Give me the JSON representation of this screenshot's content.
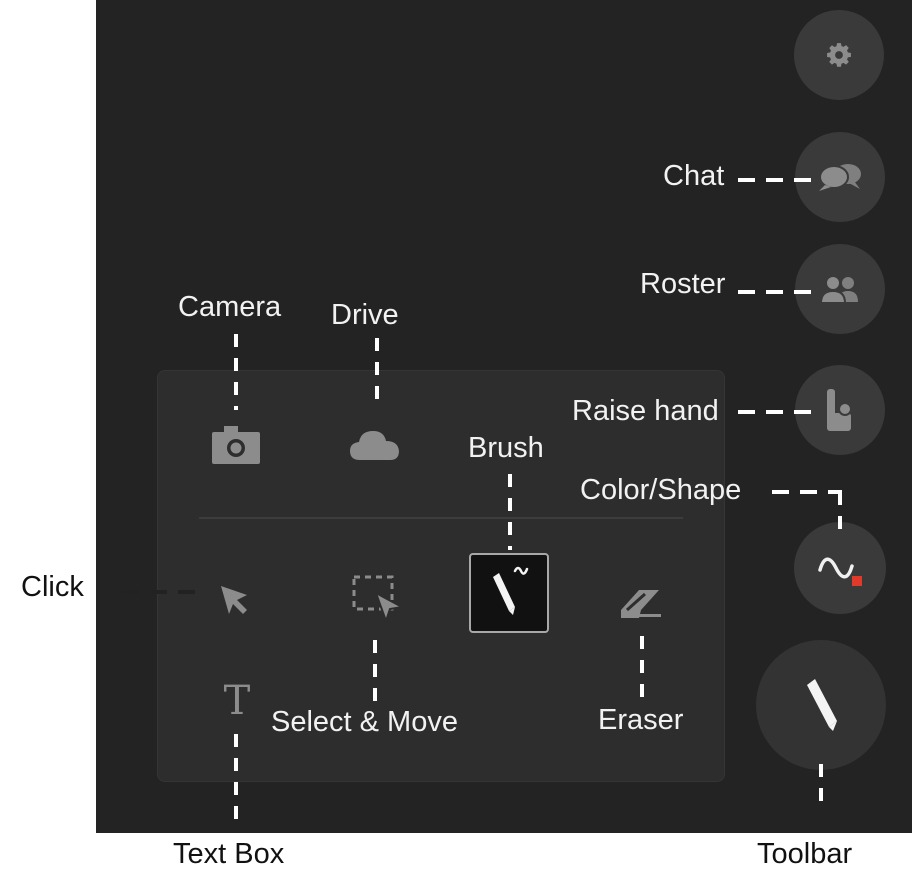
{
  "labels": {
    "chat": "Chat",
    "roster": "Roster",
    "raise_hand": "Raise hand",
    "color_shape": "Color/Shape",
    "camera": "Camera",
    "drive": "Drive",
    "brush": "Brush",
    "click": "Click",
    "select_move": "Select & Move",
    "eraser": "Eraser",
    "text_box": "Text Box",
    "toolbar": "Toolbar"
  },
  "tools": {
    "text_glyph": "T"
  },
  "icons": [
    "gear-icon",
    "chat-bubbles-icon",
    "roster-icon",
    "raise-hand-icon",
    "color-shape-icon",
    "toolbar-brush-icon",
    "camera-icon",
    "cloud-drive-icon",
    "cursor-arrow-icon",
    "select-move-icon",
    "brush-icon",
    "eraser-icon",
    "text-box-icon"
  ],
  "colors": {
    "background": "#232323",
    "panel": "#2d2d2d",
    "icon": "#8c8c8c",
    "accent_red": "#e03a2a"
  }
}
